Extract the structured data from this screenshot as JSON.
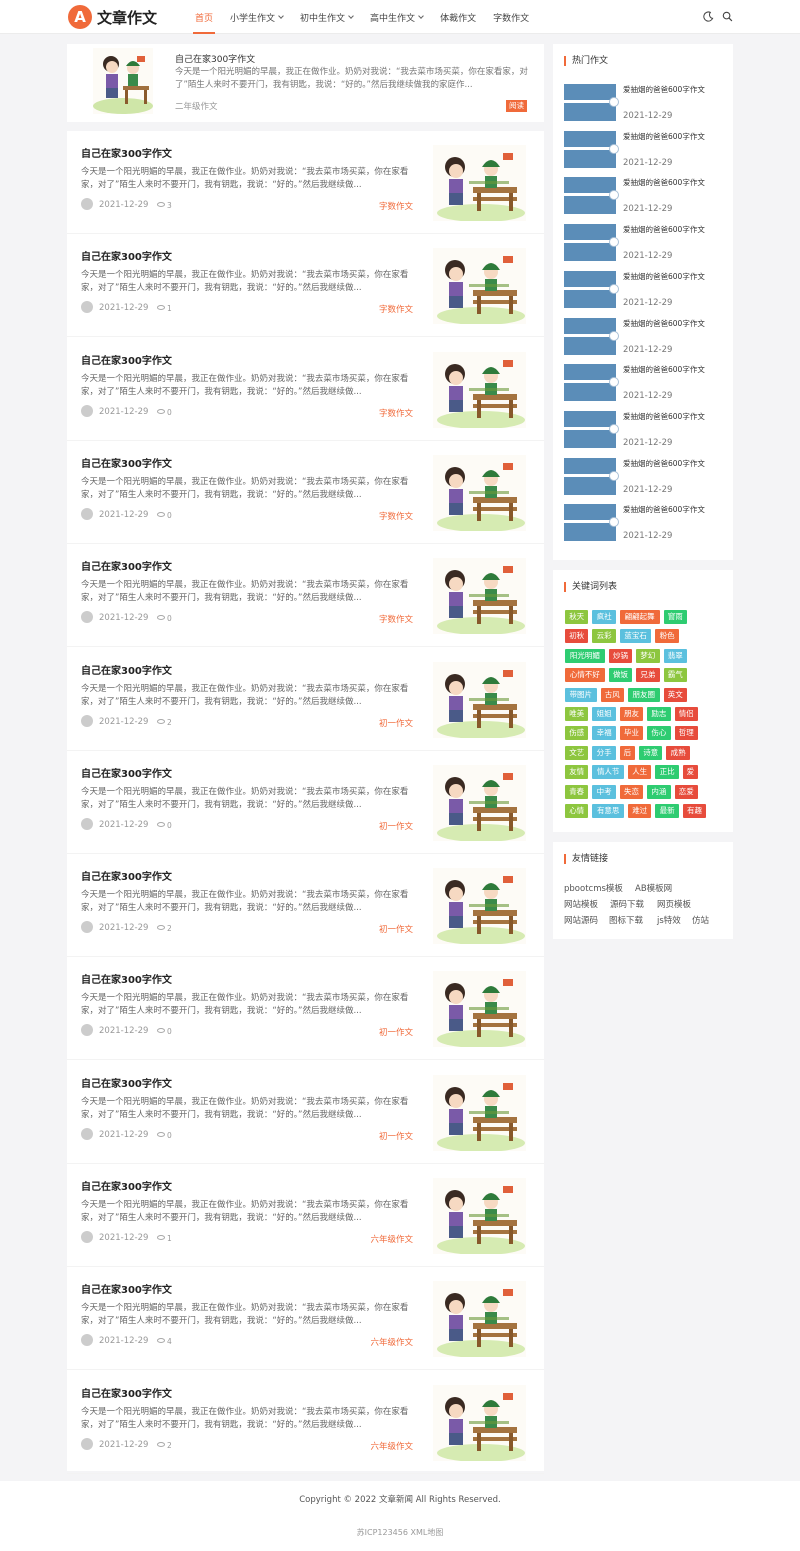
{
  "header": {
    "logo_mark": "A",
    "logo_text": "文章作文",
    "nav": [
      {
        "label": "首页",
        "active": true,
        "dropdown": false
      },
      {
        "label": "小学生作文",
        "active": false,
        "dropdown": true
      },
      {
        "label": "初中生作文",
        "active": false,
        "dropdown": true
      },
      {
        "label": "高中生作文",
        "active": false,
        "dropdown": true
      },
      {
        "label": "体裁作文",
        "active": false,
        "dropdown": false
      },
      {
        "label": "字数作文",
        "active": false,
        "dropdown": false
      }
    ],
    "icons": [
      "moon-icon",
      "search-icon"
    ]
  },
  "feature": {
    "title": "自己在家300字作文",
    "excerpt": "今天是一个阳光明媚的早晨，我正在做作业。奶奶对我说：“我去菜市场买菜，你在家看家，对了”陌生人来时不要开门，我有钥匙，我说：“好的。”然后我继续做我的家庭作...",
    "category": "二年级作文",
    "tag": "阅读"
  },
  "articles": [
    {
      "title": "自己在家300字作文",
      "excerpt": "今天是一个阳光明媚的早晨，我正在做作业。奶奶对我说：“我去菜市场买菜，你在家看家，对了”陌生人来时不要开门，我有钥匙，我说：“好的。”然后我继续做...",
      "date": "2021-12-29",
      "views": "3",
      "category": "字数作文"
    },
    {
      "title": "自己在家300字作文",
      "excerpt": "今天是一个阳光明媚的早晨，我正在做作业。奶奶对我说：“我去菜市场买菜，你在家看家，对了”陌生人来时不要开门，我有钥匙，我说：“好的。”然后我继续做...",
      "date": "2021-12-29",
      "views": "1",
      "category": "字数作文"
    },
    {
      "title": "自己在家300字作文",
      "excerpt": "今天是一个阳光明媚的早晨，我正在做作业。奶奶对我说：“我去菜市场买菜，你在家看家，对了”陌生人来时不要开门，我有钥匙，我说：“好的。”然后我继续做...",
      "date": "2021-12-29",
      "views": "0",
      "category": "字数作文"
    },
    {
      "title": "自己在家300字作文",
      "excerpt": "今天是一个阳光明媚的早晨，我正在做作业。奶奶对我说：“我去菜市场买菜，你在家看家，对了”陌生人来时不要开门，我有钥匙，我说：“好的。”然后我继续做...",
      "date": "2021-12-29",
      "views": "0",
      "category": "字数作文"
    },
    {
      "title": "自己在家300字作文",
      "excerpt": "今天是一个阳光明媚的早晨，我正在做作业。奶奶对我说：“我去菜市场买菜，你在家看家，对了”陌生人来时不要开门，我有钥匙，我说：“好的。”然后我继续做...",
      "date": "2021-12-29",
      "views": "0",
      "category": "字数作文"
    },
    {
      "title": "自己在家300字作文",
      "excerpt": "今天是一个阳光明媚的早晨，我正在做作业。奶奶对我说：“我去菜市场买菜，你在家看家，对了”陌生人来时不要开门，我有钥匙，我说：“好的。”然后我继续做...",
      "date": "2021-12-29",
      "views": "2",
      "category": "初一作文"
    },
    {
      "title": "自己在家300字作文",
      "excerpt": "今天是一个阳光明媚的早晨，我正在做作业。奶奶对我说：“我去菜市场买菜，你在家看家，对了”陌生人来时不要开门，我有钥匙，我说：“好的。”然后我继续做...",
      "date": "2021-12-29",
      "views": "0",
      "category": "初一作文"
    },
    {
      "title": "自己在家300字作文",
      "excerpt": "今天是一个阳光明媚的早晨，我正在做作业。奶奶对我说：“我去菜市场买菜，你在家看家，对了”陌生人来时不要开门，我有钥匙，我说：“好的。”然后我继续做...",
      "date": "2021-12-29",
      "views": "2",
      "category": "初一作文"
    },
    {
      "title": "自己在家300字作文",
      "excerpt": "今天是一个阳光明媚的早晨，我正在做作业。奶奶对我说：“我去菜市场买菜，你在家看家，对了”陌生人来时不要开门，我有钥匙，我说：“好的。”然后我继续做...",
      "date": "2021-12-29",
      "views": "0",
      "category": "初一作文"
    },
    {
      "title": "自己在家300字作文",
      "excerpt": "今天是一个阳光明媚的早晨，我正在做作业。奶奶对我说：“我去菜市场买菜，你在家看家，对了”陌生人来时不要开门，我有钥匙，我说：“好的。”然后我继续做...",
      "date": "2021-12-29",
      "views": "0",
      "category": "初一作文"
    },
    {
      "title": "自己在家300字作文",
      "excerpt": "今天是一个阳光明媚的早晨，我正在做作业。奶奶对我说：“我去菜市场买菜，你在家看家，对了”陌生人来时不要开门，我有钥匙，我说：“好的。”然后我继续做...",
      "date": "2021-12-29",
      "views": "1",
      "category": "六年级作文"
    },
    {
      "title": "自己在家300字作文",
      "excerpt": "今天是一个阳光明媚的早晨，我正在做作业。奶奶对我说：“我去菜市场买菜，你在家看家，对了”陌生人来时不要开门，我有钥匙，我说：“好的。”然后我继续做...",
      "date": "2021-12-29",
      "views": "4",
      "category": "六年级作文"
    },
    {
      "title": "自己在家300字作文",
      "excerpt": "今天是一个阳光明媚的早晨，我正在做作业。奶奶对我说：“我去菜市场买菜，你在家看家，对了”陌生人来时不要开门，我有钥匙，我说：“好的。”然后我继续做...",
      "date": "2021-12-29",
      "views": "2",
      "category": "六年级作文"
    }
  ],
  "sidebar": {
    "hot_title": "热门作文",
    "hot": [
      {
        "title": "爱抽烟的爸爸600字作文",
        "date": "2021-12-29"
      },
      {
        "title": "爱抽烟的爸爸600字作文",
        "date": "2021-12-29"
      },
      {
        "title": "爱抽烟的爸爸600字作文",
        "date": "2021-12-29"
      },
      {
        "title": "爱抽烟的爸爸600字作文",
        "date": "2021-12-29"
      },
      {
        "title": "爱抽烟的爸爸600字作文",
        "date": "2021-12-29"
      },
      {
        "title": "爱抽烟的爸爸600字作文",
        "date": "2021-12-29"
      },
      {
        "title": "爱抽烟的爸爸600字作文",
        "date": "2021-12-29"
      },
      {
        "title": "爱抽烟的爸爸600字作文",
        "date": "2021-12-29"
      },
      {
        "title": "爱抽烟的爸爸600字作文",
        "date": "2021-12-29"
      },
      {
        "title": "爱抽烟的爸爸600字作文",
        "date": "2021-12-29"
      }
    ],
    "tags_title": "关键词列表",
    "tag_rows": [
      [
        {
          "t": "秋天",
          "c": "#8dc63f"
        },
        {
          "t": "疯社",
          "c": "#5bc0de"
        },
        {
          "t": "翩翩起舞",
          "c": "#f06a3a"
        },
        {
          "t": "窗雨",
          "c": "#2ecc71"
        }
      ],
      [
        {
          "t": "初秋",
          "c": "#e74c3c"
        },
        {
          "t": "云彩",
          "c": "#8dc63f"
        },
        {
          "t": "蓝宝石",
          "c": "#5bc0de"
        },
        {
          "t": "粉色",
          "c": "#f06a3a"
        }
      ],
      [
        {
          "t": "阳光明媚",
          "c": "#2ecc71"
        },
        {
          "t": "炒锅",
          "c": "#e74c3c"
        },
        {
          "t": "梦幻",
          "c": "#8dc63f"
        },
        {
          "t": "翡翠",
          "c": "#5bc0de"
        }
      ],
      [
        {
          "t": "心情不好",
          "c": "#f06a3a"
        },
        {
          "t": "做饭",
          "c": "#2ecc71"
        },
        {
          "t": "兄弟",
          "c": "#e74c3c"
        },
        {
          "t": "霸气",
          "c": "#8dc63f"
        }
      ],
      [
        {
          "t": "带图片",
          "c": "#5bc0de"
        },
        {
          "t": "古风",
          "c": "#f06a3a"
        },
        {
          "t": "朋友圈",
          "c": "#2ecc71"
        },
        {
          "t": "英文",
          "c": "#e74c3c"
        }
      ],
      [
        {
          "t": "唯美",
          "c": "#8dc63f"
        },
        {
          "t": "姐姐",
          "c": "#5bc0de"
        },
        {
          "t": "朋友",
          "c": "#f06a3a"
        },
        {
          "t": "励志",
          "c": "#2ecc71"
        },
        {
          "t": "情侣",
          "c": "#e74c3c"
        }
      ],
      [
        {
          "t": "伤感",
          "c": "#8dc63f"
        },
        {
          "t": "幸福",
          "c": "#5bc0de"
        },
        {
          "t": "毕业",
          "c": "#f06a3a"
        },
        {
          "t": "伤心",
          "c": "#2ecc71"
        },
        {
          "t": "哲理",
          "c": "#e74c3c"
        }
      ],
      [
        {
          "t": "文艺",
          "c": "#8dc63f"
        },
        {
          "t": "分手",
          "c": "#5bc0de"
        },
        {
          "t": "后",
          "c": "#f06a3a"
        },
        {
          "t": "诗意",
          "c": "#2ecc71"
        },
        {
          "t": "成熟",
          "c": "#e74c3c"
        }
      ],
      [
        {
          "t": "友情",
          "c": "#8dc63f"
        },
        {
          "t": "情人节",
          "c": "#5bc0de"
        },
        {
          "t": "人生",
          "c": "#f06a3a"
        },
        {
          "t": "正比",
          "c": "#2ecc71"
        },
        {
          "t": "爱",
          "c": "#e74c3c"
        }
      ],
      [
        {
          "t": "青春",
          "c": "#8dc63f"
        },
        {
          "t": "中考",
          "c": "#5bc0de"
        },
        {
          "t": "失恋",
          "c": "#f06a3a"
        },
        {
          "t": "内涵",
          "c": "#2ecc71"
        },
        {
          "t": "恋爱",
          "c": "#e74c3c"
        }
      ],
      [
        {
          "t": "心情",
          "c": "#8dc63f"
        },
        {
          "t": "有意思",
          "c": "#5bc0de"
        },
        {
          "t": "难过",
          "c": "#f06a3a"
        },
        {
          "t": "最新",
          "c": "#2ecc71"
        },
        {
          "t": "有趣",
          "c": "#e74c3c"
        }
      ]
    ],
    "links_title": "友情链接",
    "link_rows": [
      [
        "pbootcms模板",
        "AB模板网"
      ],
      [
        "网站模板",
        "源码下载",
        "网页模板"
      ],
      [
        "网站源码",
        "图标下载",
        "js特效",
        "仿站"
      ]
    ]
  },
  "footer": {
    "copyright": "Copyright © 2022 文章新闻 All Rights Reserved.",
    "icp": "苏ICP123456 XML地图"
  },
  "colors": {
    "accent": "#f06a3a",
    "page_bg": "#f4f4f6"
  }
}
